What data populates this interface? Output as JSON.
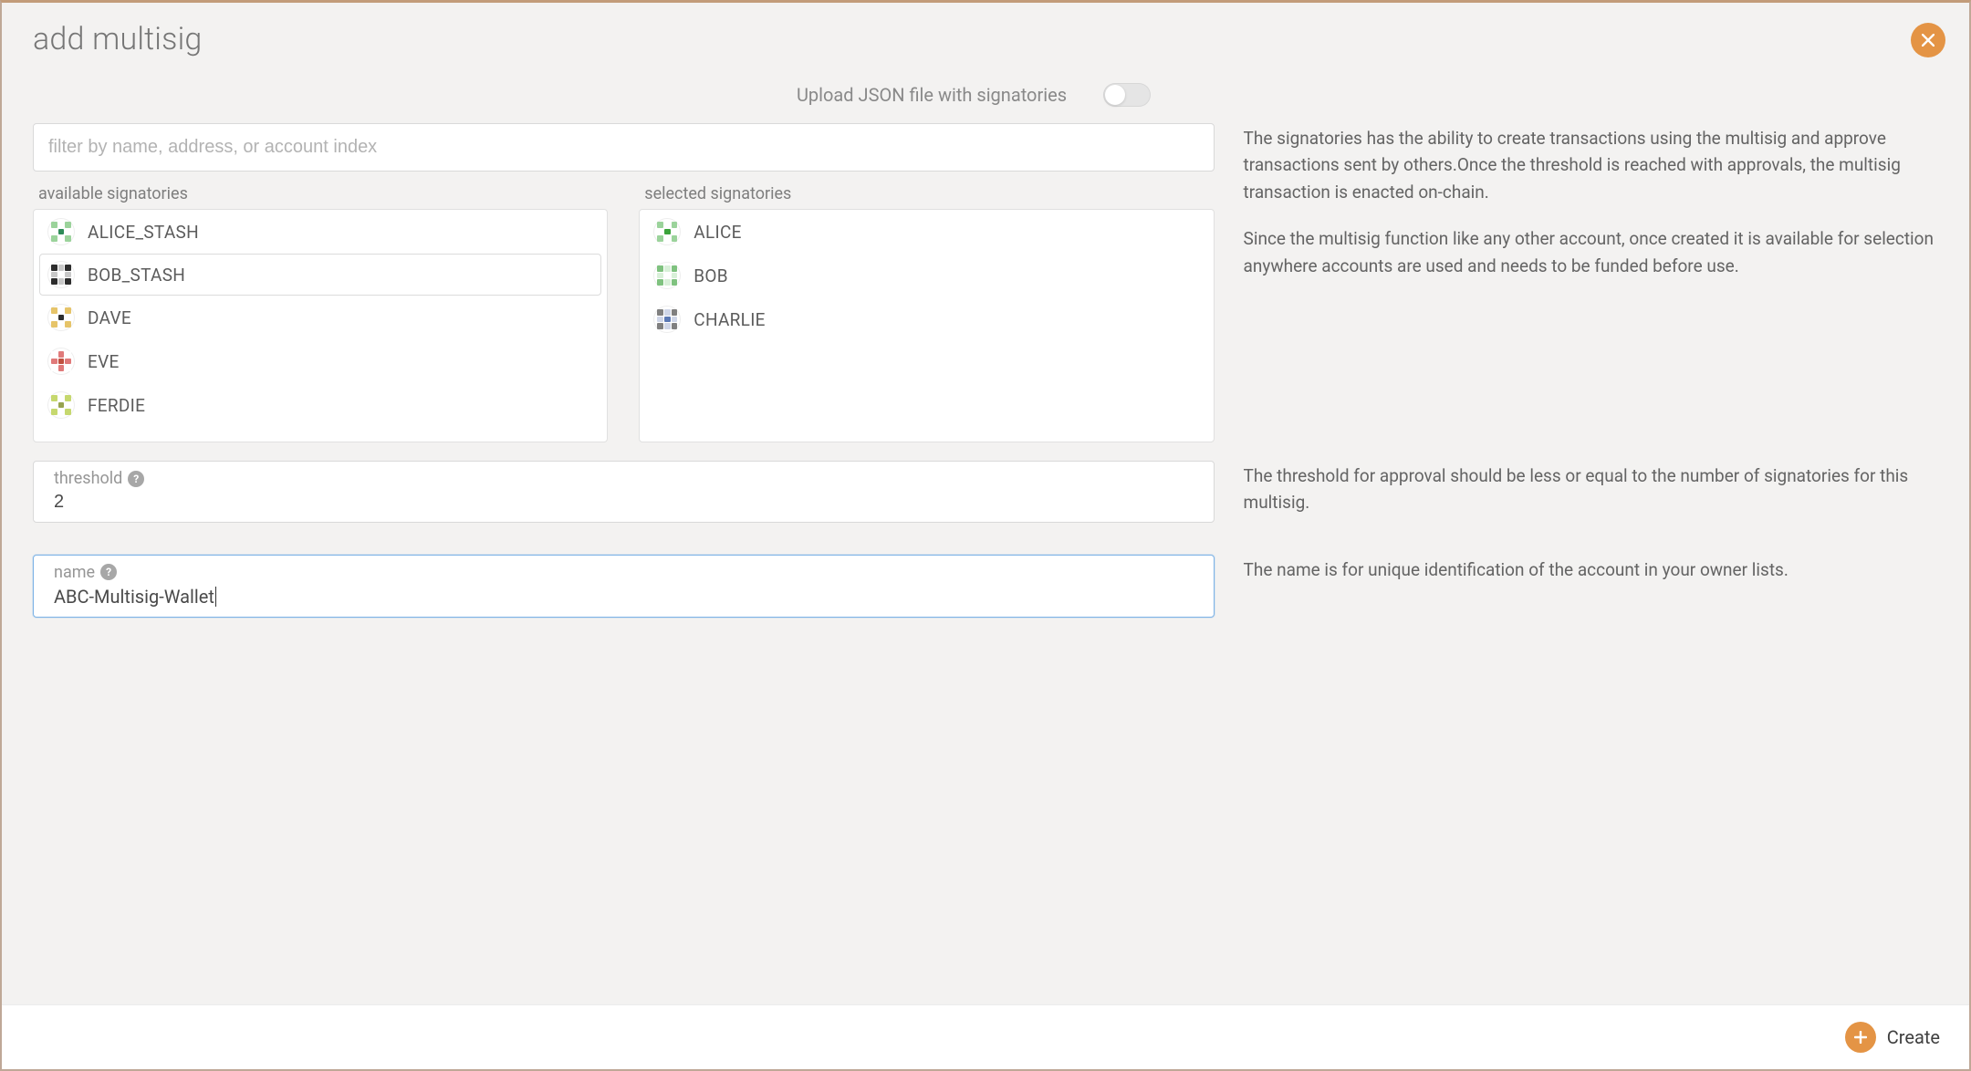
{
  "title": "add multisig",
  "uploadToggle": {
    "label": "Upload JSON file with signatories",
    "on": false
  },
  "filter": {
    "placeholder": "filter by name, address, or account index"
  },
  "lists": {
    "availableLabel": "available signatories",
    "selectedLabel": "selected signatories",
    "available": [
      {
        "name": "ALICE_STASH",
        "colors": [
          "#9bd39b",
          "#fff",
          "#9bd39b",
          "#fff",
          "#2e8b57",
          "#fff",
          "#9bd39b",
          "#fff",
          "#9bd39b"
        ]
      },
      {
        "name": "BOB_STASH",
        "colors": [
          "#2d2d2d",
          "#c8c8c8",
          "#2d2d2d",
          "#c8c8c8",
          "#fff",
          "#c8c8c8",
          "#2d2d2d",
          "#c8c8c8",
          "#2d2d2d"
        ]
      },
      {
        "name": "DAVE",
        "colors": [
          "#e6c469",
          "#fff",
          "#e6c469",
          "#fff",
          "#2d2d2d",
          "#fff",
          "#e6c469",
          "#fff",
          "#e6c469"
        ]
      },
      {
        "name": "EVE",
        "colors": [
          "#fff",
          "#e07a7a",
          "#fff",
          "#e07a7a",
          "#c0503f",
          "#e07a7a",
          "#fff",
          "#e07a7a",
          "#fff"
        ]
      },
      {
        "name": "FERDIE",
        "colors": [
          "#c6d86e",
          "#fff",
          "#c6d86e",
          "#fff",
          "#97a34f",
          "#fff",
          "#c6d86e",
          "#fff",
          "#c6d86e"
        ]
      }
    ],
    "selected": [
      {
        "name": "ALICE",
        "colors": [
          "#9bd39b",
          "#fff",
          "#9bd39b",
          "#fff",
          "#3aa33a",
          "#fff",
          "#9bd39b",
          "#fff",
          "#9bd39b"
        ]
      },
      {
        "name": "BOB",
        "colors": [
          "#7fc27f",
          "#d9f0d9",
          "#7fc27f",
          "#d9f0d9",
          "#fff",
          "#d9f0d9",
          "#7fc27f",
          "#d9f0d9",
          "#7fc27f"
        ]
      },
      {
        "name": "CHARLIE",
        "colors": [
          "#808080",
          "#cfd6e8",
          "#808080",
          "#cfd6e8",
          "#5b79b5",
          "#cfd6e8",
          "#808080",
          "#cfd6e8",
          "#808080"
        ]
      }
    ]
  },
  "threshold": {
    "label": "threshold",
    "value": "2"
  },
  "name": {
    "label": "name",
    "value": "ABC-Multisig-Wallet"
  },
  "help": {
    "signatories1": "The signatories has the ability to create transactions using the multisig and approve transactions sent by others.Once the threshold is reached with approvals, the multisig transaction is enacted on-chain.",
    "signatories2": "Since the multisig function like any other account, once created it is available for selection anywhere accounts are used and needs to be funded before use.",
    "threshold": "The threshold for approval should be less or equal to the number of signatories for this multisig.",
    "name": "The name is for unique identification of the account in your owner lists."
  },
  "footer": {
    "create": "Create"
  },
  "icons": {
    "close": "close-icon",
    "plus": "plus-icon",
    "help": "help-icon"
  }
}
